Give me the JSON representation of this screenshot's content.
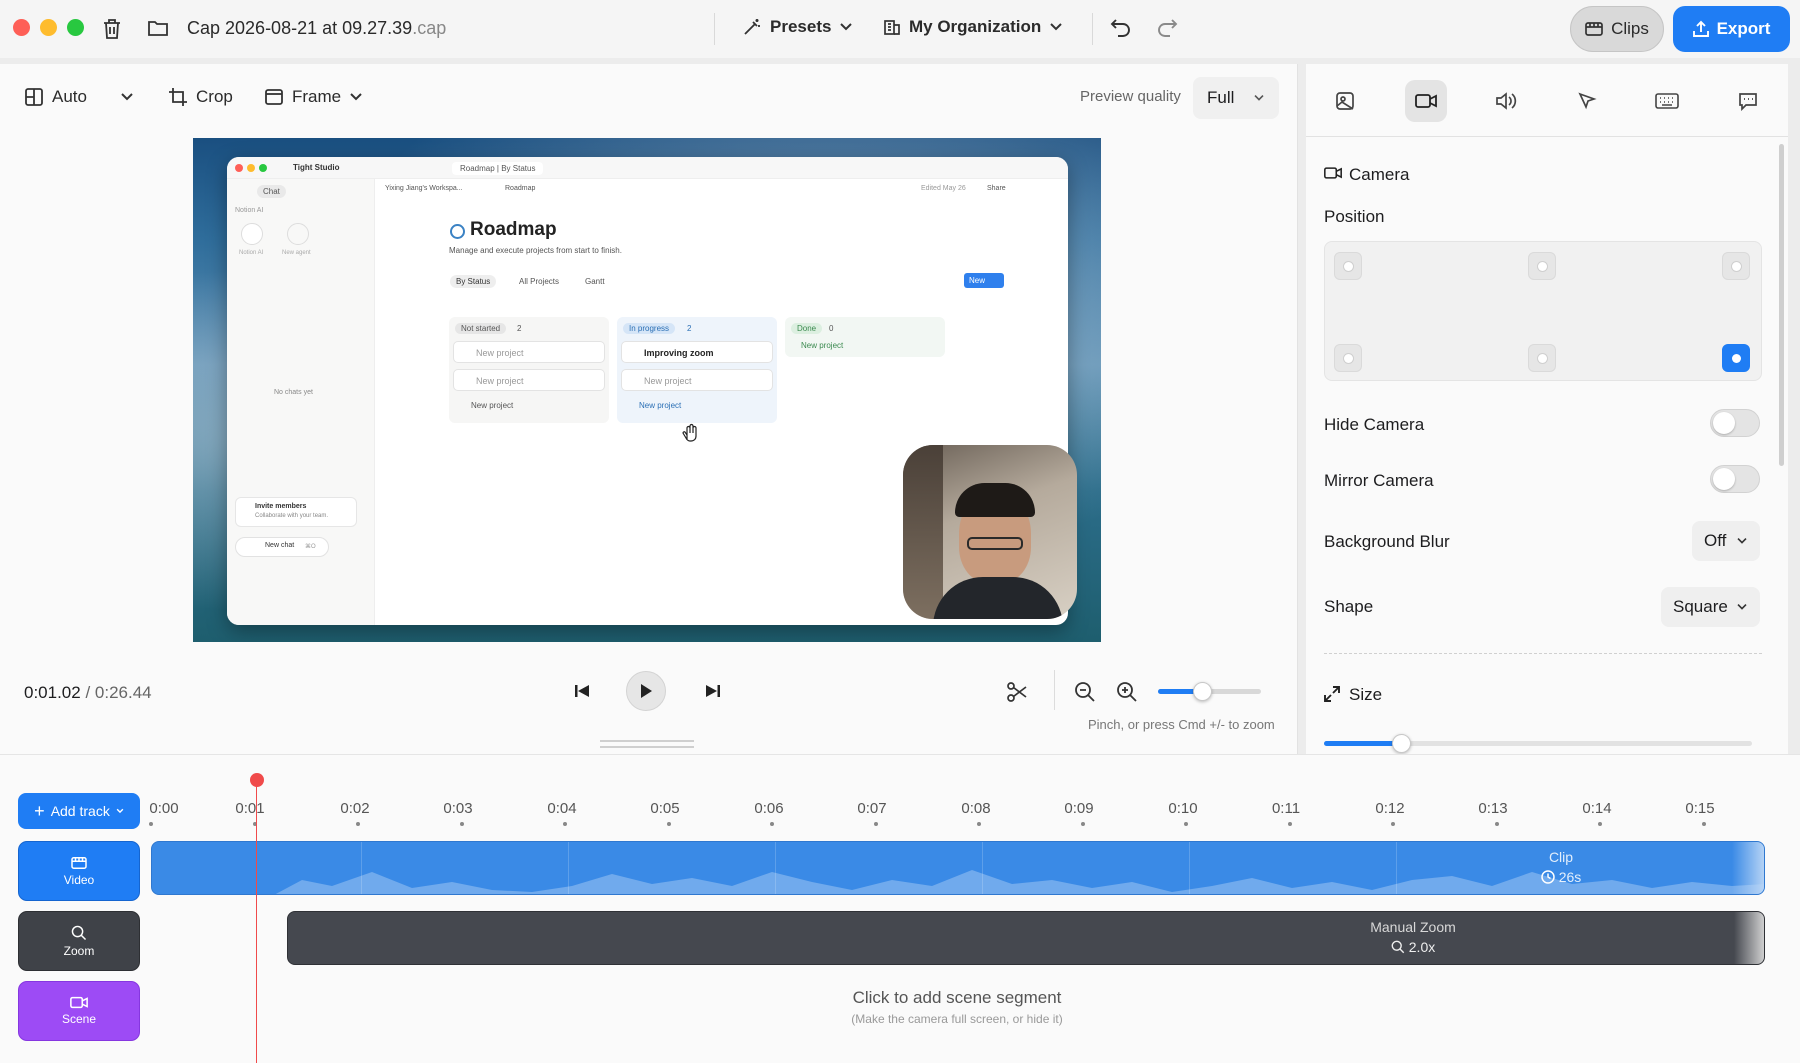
{
  "titlebar": {
    "file_name": "Cap 2026-08-21 at 09.27.39",
    "file_ext": ".cap",
    "presets_label": "Presets",
    "organization_label": "My Organization",
    "clips_label": "Clips",
    "export_label": "Export"
  },
  "toolbar": {
    "layout_label": "Auto",
    "crop_label": "Crop",
    "frame_label": "Frame",
    "preview_quality_label": "Preview quality",
    "preview_quality_value": "Full"
  },
  "preview": {
    "app_title": "Tight Studio",
    "browser_tab": "Roadmap | By Status",
    "sidebar_chat": "Chat",
    "sidebar_section": "Notion AI",
    "agent_1": "Notion AI",
    "agent_2": "New agent",
    "no_chats": "No chats yet",
    "invite_title": "Invite members",
    "invite_subtitle": "Collaborate with your team.",
    "new_chat": "New chat",
    "new_chat_shortcut": "⌘O",
    "breadcrumb_workspace": "Yixing Jiang's Workspa...",
    "breadcrumb_page": "Roadmap",
    "edited": "Edited May 26",
    "share": "Share",
    "page_title": "Roadmap",
    "page_subtitle": "Manage and execute projects from start to finish.",
    "views": [
      "By Status",
      "All Projects",
      "Gantt"
    ],
    "new_button": "New",
    "columns": [
      {
        "name": "Not started",
        "count": "2",
        "cards": [
          "New project",
          "New project"
        ],
        "add": "New project"
      },
      {
        "name": "In progress",
        "count": "2",
        "cards": [
          "Improving zoom",
          "New project"
        ],
        "add": "New project"
      },
      {
        "name": "Done",
        "count": "0",
        "cards": [],
        "add": "New project"
      }
    ]
  },
  "playback": {
    "current_time": "0:01.02",
    "total_time": "0:26.44",
    "zoom_hint": "Pinch, or press Cmd +/- to zoom",
    "zoom_level": 0.43
  },
  "inspector": {
    "section_title": "Camera",
    "position_label": "Position",
    "position_selected": "bottom-right",
    "hide_camera_label": "Hide Camera",
    "hide_camera": false,
    "mirror_camera_label": "Mirror Camera",
    "mirror_camera": false,
    "background_blur_label": "Background Blur",
    "background_blur_value": "Off",
    "shape_label": "Shape",
    "shape_value": "Square",
    "size_label": "Size",
    "size_level": 0.18
  },
  "timeline": {
    "add_track_label": "Add track",
    "ticks": [
      "0:00",
      "0:01",
      "0:02",
      "0:03",
      "0:04",
      "0:05",
      "0:06",
      "0:07",
      "0:08",
      "0:09",
      "0:10",
      "0:11",
      "0:12",
      "0:13",
      "0:14",
      "0:15"
    ],
    "tracks": {
      "video_label": "Video",
      "zoom_label": "Zoom",
      "scene_label": "Scene"
    },
    "clip_label": "Clip",
    "clip_duration": "26s",
    "zoom_segment_label": "Manual Zoom",
    "zoom_segment_value": "2.0x",
    "scene_hint": "Click to add scene segment",
    "scene_subhint": "(Make the camera full screen, or hide it)"
  }
}
